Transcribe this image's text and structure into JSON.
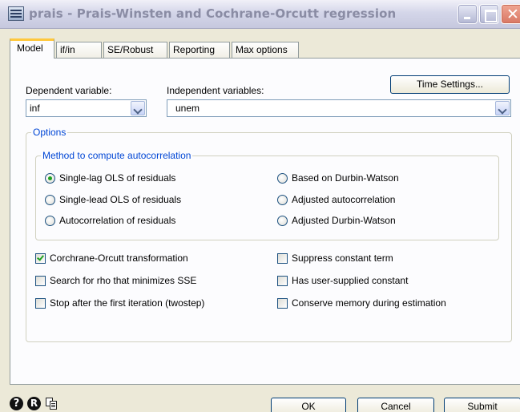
{
  "window": {
    "title": "prais - Prais-Winsten and Cochrane-Orcutt regression",
    "icon": "stata-dialog-icon"
  },
  "tabs": [
    {
      "label": "Model",
      "active": true
    },
    {
      "label": "if/in",
      "active": false
    },
    {
      "label": "SE/Robust",
      "active": false
    },
    {
      "label": "Reporting",
      "active": false
    },
    {
      "label": "Max options",
      "active": false
    }
  ],
  "model": {
    "dependent_label": "Dependent variable:",
    "dependent_value": "inf",
    "independent_label": "Independent variables:",
    "independent_value": "unem",
    "time_settings_label": "Time Settings..."
  },
  "options": {
    "title": "Options",
    "method": {
      "title": "Method to compute autocorrelation",
      "choices": [
        {
          "label": "Single-lag OLS of residuals",
          "selected": true
        },
        {
          "label": "Single-lead OLS of residuals",
          "selected": false
        },
        {
          "label": "Autocorrelation of residuals",
          "selected": false
        },
        {
          "label": "Based on Durbin-Watson",
          "selected": false
        },
        {
          "label": "Adjusted autocorrelation",
          "selected": false
        },
        {
          "label": "Adjusted Durbin-Watson",
          "selected": false
        }
      ]
    },
    "checks": [
      {
        "label": "Corchrane-Orcutt transformation",
        "checked": true
      },
      {
        "label": "Search for rho that minimizes SSE",
        "checked": false
      },
      {
        "label": "Stop after the first iteration (twostep)",
        "checked": false
      },
      {
        "label": "Suppress constant term",
        "checked": false
      },
      {
        "label": "Has user-supplied constant",
        "checked": false
      },
      {
        "label": "Conserve memory during estimation",
        "checked": false
      }
    ]
  },
  "footer": {
    "ok_label": "OK",
    "cancel_label": "Cancel",
    "submit_label": "Submit",
    "icons": [
      "help-icon",
      "reset-icon",
      "copy-icon"
    ]
  },
  "colors": {
    "group_title": "#0046d5",
    "radio_dot": "#21a121",
    "tab_highlight": "#ffc83c",
    "dialog_bg": "#ECE9D8"
  }
}
